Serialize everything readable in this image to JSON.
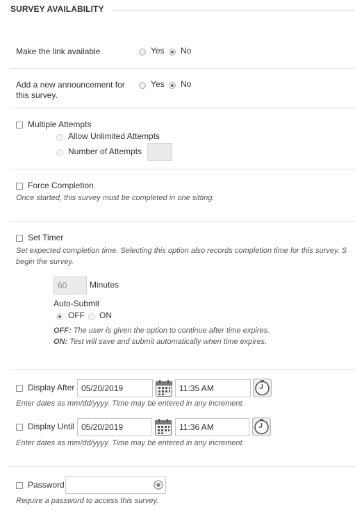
{
  "section_title": "SURVEY AVAILABILITY",
  "make_link": {
    "label": "Make the link available",
    "yes": "Yes",
    "no": "No",
    "selected": "No"
  },
  "announcement": {
    "label_line1": "Add a new announcement for",
    "label_line2": "this survey.",
    "yes": "Yes",
    "no": "No",
    "selected": "No"
  },
  "multiple_attempts": {
    "label": "Multiple Attempts",
    "unlimited": "Allow Unlimited Attempts",
    "number": "Number of Attempts",
    "number_value": ""
  },
  "force_completion": {
    "label": "Force Completion",
    "hint": "Once started, this survey must be completed in one sitting."
  },
  "timer": {
    "label": "Set Timer",
    "hint_line1": "Set expected completion time. Selecting this option also records completion time for this survey. S",
    "hint_line2": "begin the survey.",
    "minutes_value": "60",
    "minutes_label": "Minutes",
    "auto_submit_label": "Auto-Submit",
    "off": "OFF",
    "on": "ON",
    "selected": "OFF",
    "off_desc_key": "OFF:",
    "off_desc": " The user is given the option to continue after time expires.",
    "on_desc_key": "ON:",
    "on_desc": " Test will save and submit automatically when time expires."
  },
  "display_after": {
    "label": "Display After",
    "date": "05/20/2019",
    "time": "11:35 AM",
    "hint": "Enter dates as mm/dd/yyyy. Time may be entered in any increment."
  },
  "display_until": {
    "label": "Display Until",
    "date": "05/20/2019",
    "time": "11:36 AM",
    "hint": "Enter dates as mm/dd/yyyy. Time may be entered in any increment."
  },
  "password": {
    "label": "Password",
    "value": "",
    "hint": "Require a password to access this survey."
  }
}
